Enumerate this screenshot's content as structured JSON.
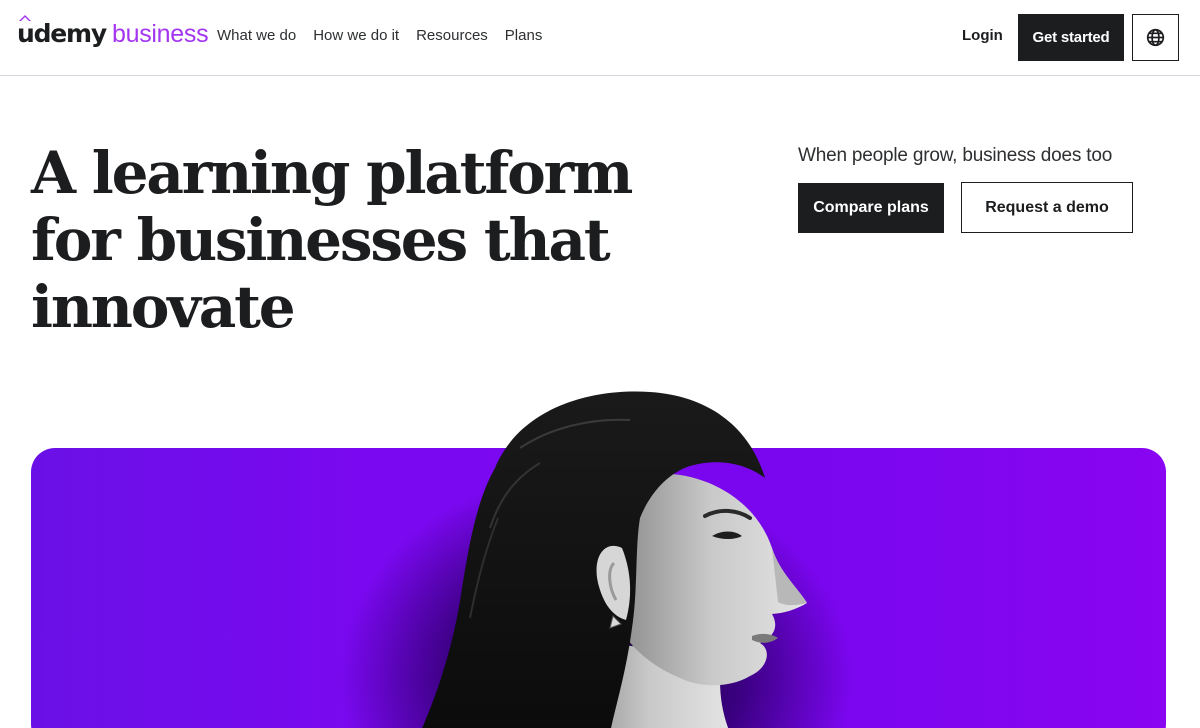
{
  "header": {
    "logo": {
      "brand": "udemy",
      "product": "business",
      "brand_color": "#1c1d1f",
      "accent_color": "#a435f0"
    },
    "nav": [
      "What we do",
      "How we do it",
      "Resources",
      "Plans"
    ],
    "login_label": "Login",
    "get_started_label": "Get started",
    "globe_icon": "globe-icon"
  },
  "hero": {
    "headline_lines": [
      "A learning platform",
      "for businesses that",
      "innovate"
    ],
    "tagline": "When people grow, business does too",
    "compare_label": "Compare plans",
    "demo_label": "Request a demo"
  },
  "panel": {
    "background_color": "#7a08f0",
    "image": "black-and-white portrait photo"
  }
}
